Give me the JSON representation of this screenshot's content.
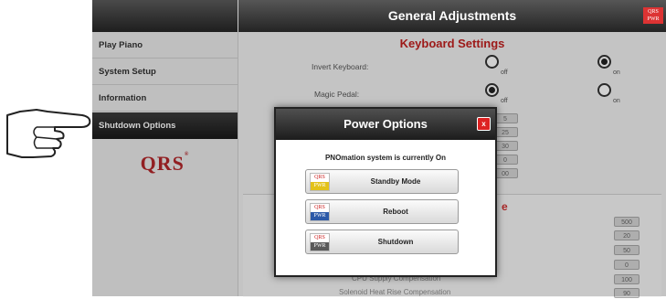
{
  "sidebar": {
    "items": [
      {
        "label": "Play Piano"
      },
      {
        "label": "System Setup"
      },
      {
        "label": "Information"
      },
      {
        "label": "Shutdown Options"
      }
    ],
    "logo": "QRS",
    "logo_mark": "®"
  },
  "header": {
    "title": "General Adjustments",
    "badge_line1": "QRS",
    "badge_line2": "PWR"
  },
  "main": {
    "section_title": "Keyboard Settings",
    "settings": [
      {
        "label": "Invert Keyboard:",
        "off_label": "off",
        "on_label": "on",
        "selected": "on"
      },
      {
        "label": "Magic Pedal:",
        "off_label": "off",
        "on_label": "on",
        "selected": "off"
      }
    ],
    "partial_values": [
      "5",
      "25",
      "30",
      "0",
      "00"
    ],
    "lower_section_letter": "e",
    "lower_values": [
      "500",
      "20",
      "50",
      "0",
      "100",
      "90"
    ],
    "lower_labels": [
      "CPU Supply Compensation",
      "Solenoid Heat Rise Compensation"
    ]
  },
  "modal": {
    "title": "Power Options",
    "close_label": "x",
    "status": "PNOmation system is currently On",
    "buttons": [
      {
        "label": "Standby Mode",
        "icon_top": "QRS",
        "icon_bottom": "PWR",
        "icon_color": "#e3c21a"
      },
      {
        "label": "Reboot",
        "icon_top": "QRS",
        "icon_bottom": "PWR",
        "icon_color": "#2d5aa8"
      },
      {
        "label": "Shutdown",
        "icon_top": "QRS",
        "icon_bottom": "PWR",
        "icon_color": "#5a5a5a"
      }
    ]
  },
  "icons": {
    "pointer": "pointing-hand-icon",
    "close": "close-icon",
    "power_badge": "qrs-pwr-icon"
  },
  "colors": {
    "accent_red": "#c0201f",
    "header_dark": "#242424"
  }
}
